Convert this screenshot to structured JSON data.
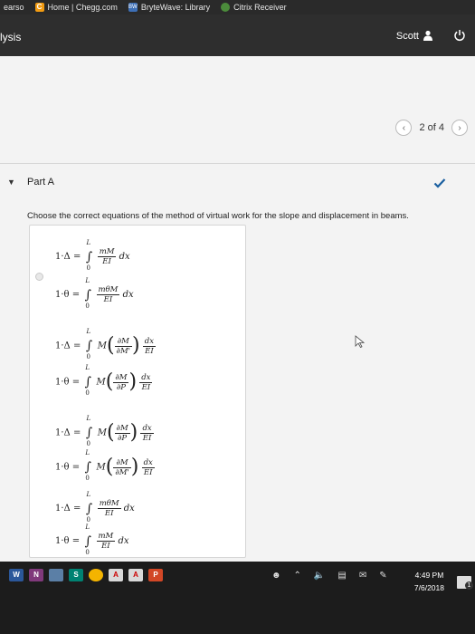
{
  "bookmarks": {
    "items": [
      {
        "label": "earso",
        "icon": "pearson-icon"
      },
      {
        "label": "Home | Chegg.com",
        "icon": "chegg-icon"
      },
      {
        "label": "BryteWave: Library",
        "icon": "brytewave-icon"
      },
      {
        "label": "Citrix Receiver",
        "icon": "citrix-icon"
      }
    ]
  },
  "header": {
    "title": "lysis",
    "user_name": "Scott",
    "user_icon": "user-icon",
    "power_icon": "power-icon"
  },
  "pager": {
    "prev_icon": "chevron-left-icon",
    "label": "2 of 4",
    "next_icon": "chevron-right-icon"
  },
  "part": {
    "title": "Part A",
    "caret_icon": "caret-down-icon",
    "status_icon": "checkmark-icon",
    "status_color": "#1a5fa0"
  },
  "question": {
    "instructions": "Choose the correct equations of the method of virtual work for the slope and displacement in beams."
  },
  "options": [
    {
      "id": 1,
      "eq1": {
        "lhs": "1·Δ =",
        "upper": "L",
        "lower": "0",
        "num": "mM",
        "den": "EI",
        "tail": "dx"
      },
      "eq2": {
        "lhs": "1·θ =",
        "upper": "L",
        "lower": "0",
        "num": "mθM",
        "den": "EI",
        "tail": "dx"
      }
    },
    {
      "id": 2,
      "eq1": {
        "lhs": "1·Δ =",
        "upper": "L",
        "lower": "0",
        "m": "M",
        "pnum": "∂M",
        "pden": "∂M'",
        "fnum": "dx",
        "fden": "EI"
      },
      "eq2": {
        "lhs": "1·θ =",
        "upper": "L",
        "lower": "0",
        "m": "M",
        "pnum": "∂M",
        "pden": "∂P",
        "fnum": "dx",
        "fden": "EI"
      }
    },
    {
      "id": 3,
      "eq1": {
        "lhs": "1·Δ =",
        "upper": "L",
        "lower": "0",
        "m": "M",
        "pnum": "∂M",
        "pden": "∂P",
        "fnum": "dx",
        "fden": "EI"
      },
      "eq2": {
        "lhs": "1·θ =",
        "upper": "L",
        "lower": "0",
        "m": "M",
        "pnum": "∂M",
        "pden": "∂M'",
        "fnum": "dx",
        "fden": "EI"
      }
    },
    {
      "id": 4,
      "eq1": {
        "lhs": "1·Δ =",
        "upper": "L",
        "lower": "0",
        "num": "mθM",
        "den": "EI",
        "tail": "dx"
      },
      "eq2": {
        "lhs": "1·θ =",
        "upper": "L",
        "lower": "0",
        "num": "mM",
        "den": "EI",
        "tail": "dx"
      }
    }
  ],
  "taskbar": {
    "icons": [
      "word-icon",
      "onenote-icon",
      "cloud-icon",
      "sway-icon",
      "chrome-icon",
      "acrobat-icon",
      "acrobat-dc-icon",
      "powerpoint-icon"
    ],
    "icon_labels": [
      "W",
      "N",
      "",
      "S",
      "",
      "A",
      "A",
      "P"
    ],
    "tray": [
      "people-icon",
      "chevron-up-icon",
      "volume-icon",
      "network-icon",
      "message-icon",
      "pen-icon"
    ],
    "time": "4:49 PM",
    "date": "7/6/2018",
    "notification_count": "1"
  }
}
